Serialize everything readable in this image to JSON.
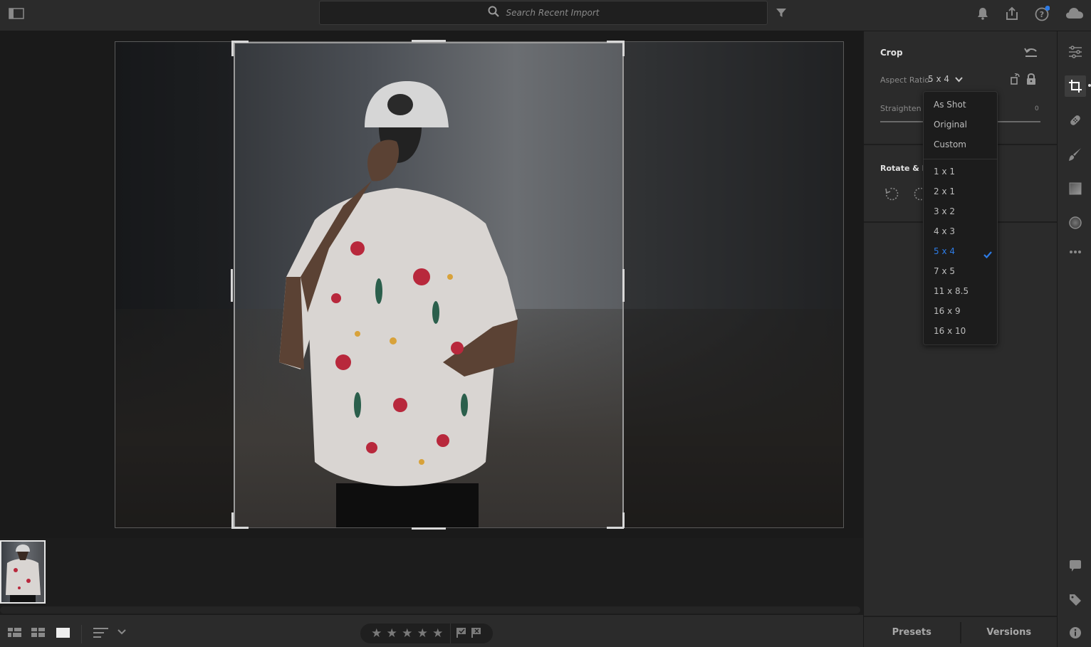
{
  "topbar": {
    "search_placeholder": "Search Recent Import",
    "icons": [
      "panel-toggle-icon",
      "search-icon",
      "filter-icon",
      "bell-icon",
      "share-icon",
      "help-icon",
      "cloud-icon"
    ],
    "notification_dot_color": "#2d7be5"
  },
  "crop_panel": {
    "title": "Crop",
    "aspect_ratio_label": "Aspect Ratio",
    "aspect_ratio_value": "5 x 4",
    "straighten_label": "Straighten",
    "straighten_value": "0",
    "rotate_flip_label": "Rotate & Flip"
  },
  "aspect_dropdown": {
    "top_options": [
      "As Shot",
      "Original",
      "Custom"
    ],
    "ratio_options": [
      "1 x 1",
      "2 x 1",
      "3 x 2",
      "4 x 3",
      "5 x 4",
      "7 x 5",
      "11 x 8.5",
      "16 x 9",
      "16 x 10"
    ],
    "selected": "5 x 4",
    "selected_color": "#2d7be5"
  },
  "tools": [
    "edit-sliders-icon",
    "crop-icon",
    "healing-icon",
    "brush-icon",
    "linear-gradient-icon",
    "radial-gradient-icon",
    "more-icon"
  ],
  "tools_bottom": [
    "comment-icon",
    "tag-icon",
    "info-icon"
  ],
  "bottom_tabs": {
    "presets": "Presets",
    "versions": "Versions"
  },
  "rating": {
    "stars": 5,
    "value": 0
  }
}
